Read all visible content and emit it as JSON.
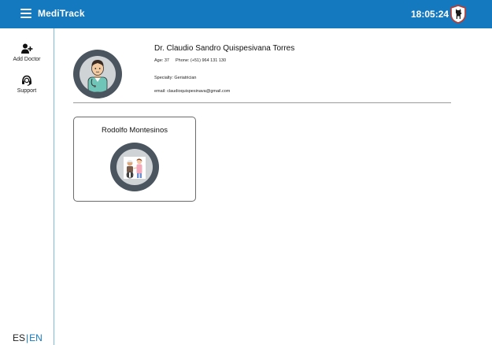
{
  "header": {
    "app_title": "MediTrack",
    "clock": "18:05:24",
    "brand_color": "#1479bf"
  },
  "sidebar": {
    "items": [
      {
        "label": "Add Doctor",
        "icon": "add-user-icon"
      },
      {
        "label": "Support",
        "icon": "headset-icon"
      }
    ],
    "language": {
      "es": "ES",
      "separator": "|",
      "en": "EN",
      "active": "EN"
    }
  },
  "doctor": {
    "name": "Dr. Claudio Sandro Quispesivana Torres",
    "age": "Age: 37",
    "phone": "Phone: (+51) 964 131 130",
    "specialty": "Specialty: Geriatrician",
    "email": "email: claudioquispesinava@gmail.com",
    "icon": "doctor-avatar-icon"
  },
  "patients": [
    {
      "name": "Rodolfo Montesinos",
      "icon": "patient-avatar-icon"
    }
  ]
}
